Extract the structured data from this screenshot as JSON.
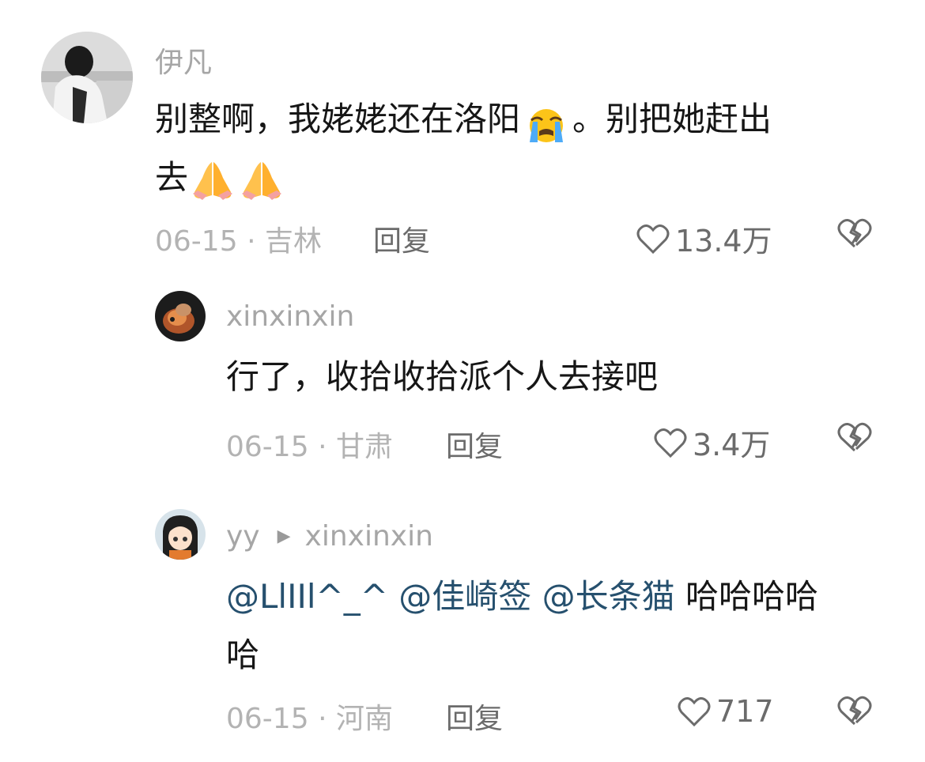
{
  "comments": [
    {
      "username": "伊凡",
      "text_lines": [
        "别整啊，我姥姥还在洛阳",
        "。别把她赶出",
        "去"
      ],
      "date": "06-15",
      "location": "吉林",
      "reply_label": "回复",
      "likes": "13.4万",
      "icons": {
        "like": "heart-outline-icon",
        "dislike": "broken-heart-icon"
      }
    },
    {
      "username": "xinxinxin",
      "text": "行了，收拾收拾派个人去接吧",
      "date": "06-15",
      "location": "甘肃",
      "reply_label": "回复",
      "likes": "3.4万"
    },
    {
      "username": "yy",
      "reply_to": "xinxinxin",
      "mentions": [
        "@LlIIl^_^",
        "@佳崎签",
        "@长条猫"
      ],
      "text_after_mentions": " 哈哈哈哈",
      "text_line2": "哈",
      "date": "06-15",
      "location": "河南",
      "reply_label": "回复",
      "likes": "717"
    }
  ],
  "meta_separator": "·"
}
